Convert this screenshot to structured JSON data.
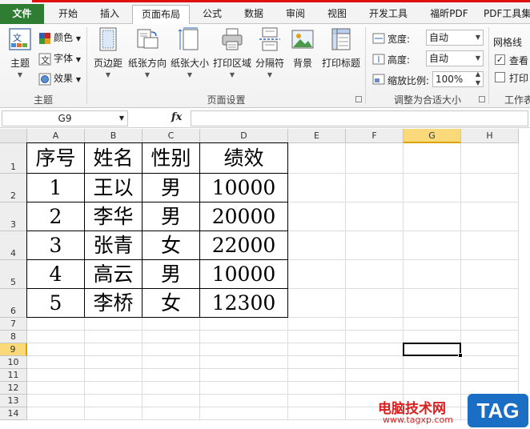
{
  "ribbon": {
    "tabs": [
      {
        "label": "文件",
        "active": false,
        "file": true
      },
      {
        "label": "开始",
        "active": false
      },
      {
        "label": "插入",
        "active": false
      },
      {
        "label": "页面布局",
        "active": true
      },
      {
        "label": "公式",
        "active": false
      },
      {
        "label": "数据",
        "active": false
      },
      {
        "label": "审阅",
        "active": false
      },
      {
        "label": "视图",
        "active": false
      },
      {
        "label": "开发工具",
        "active": false
      },
      {
        "label": "福昕PDF",
        "active": false
      },
      {
        "label": "PDF工具集",
        "active": false
      }
    ],
    "theme": {
      "themes_label": "主题",
      "colors_label": "颜色",
      "fonts_label": "字体",
      "effects_label": "效果",
      "group_label": "主题"
    },
    "page_setup": {
      "margins_label": "页边距",
      "orientation_label": "纸张方向",
      "size_label": "纸张大小",
      "print_area_label": "打印区域",
      "breaks_label": "分隔符",
      "background_label": "背景",
      "print_titles_label": "打印标题",
      "group_label": "页面设置"
    },
    "scale_to_fit": {
      "width_label": "宽度:",
      "width_value": "自动",
      "height_label": "高度:",
      "height_value": "自动",
      "scale_label": "缩放比例:",
      "scale_value": "100%",
      "group_label": "调整为合适大小"
    },
    "sheet_options": {
      "gridlines_label": "网格线",
      "view_label": "查看",
      "view_checked": true,
      "print_label": "打印",
      "print_checked": false,
      "group_label": "工作表"
    }
  },
  "formula_bar": {
    "name_box": "G9",
    "fx_label": "fx",
    "formula": ""
  },
  "sheet": {
    "columns": [
      "A",
      "B",
      "C",
      "D",
      "E",
      "F",
      "G",
      "H"
    ],
    "selected_column": "G",
    "rows": [
      "1",
      "2",
      "3",
      "4",
      "5",
      "6",
      "7",
      "8",
      "9",
      "10",
      "11",
      "12",
      "13",
      "14"
    ],
    "selected_row": "9",
    "table": [
      [
        "序号",
        "姓名",
        "性别",
        "绩效"
      ],
      [
        "1",
        "王以",
        "男",
        "10000"
      ],
      [
        "2",
        "李华",
        "男",
        "20000"
      ],
      [
        "3",
        "张青",
        "女",
        "22000"
      ],
      [
        "4",
        "高云",
        "男",
        "10000"
      ],
      [
        "5",
        "李桥",
        "女",
        "12300"
      ]
    ]
  },
  "watermark": {
    "site_name": "电脑技术网",
    "url": "www.tagxp.com",
    "badge": "TAG"
  }
}
